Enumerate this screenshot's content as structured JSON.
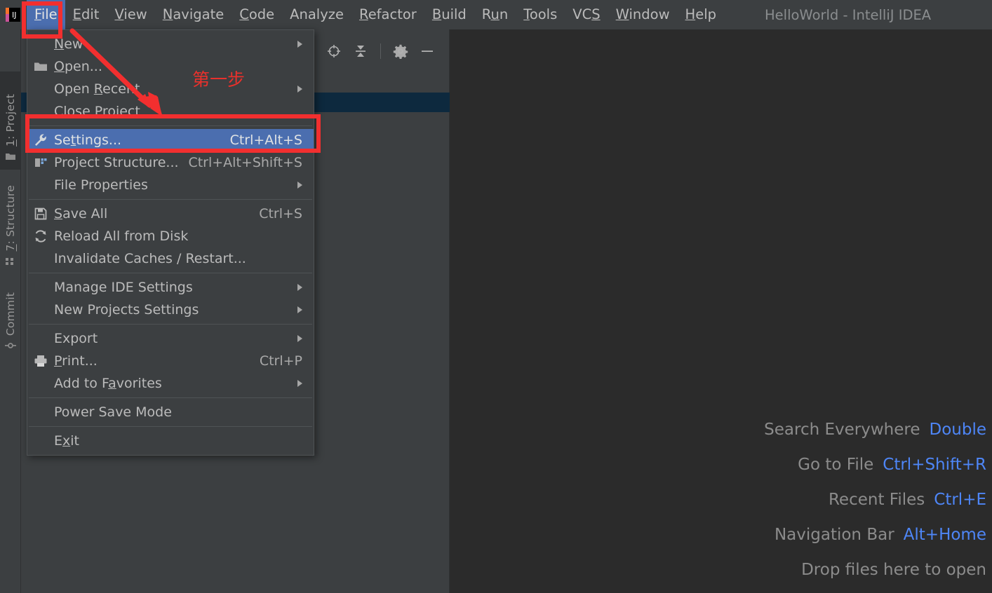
{
  "window": {
    "title": "HelloWorld - IntelliJ IDEA"
  },
  "menubar": {
    "items": [
      {
        "label": "File",
        "mnemonic": "F",
        "active": true
      },
      {
        "label": "Edit",
        "mnemonic": "E",
        "active": false
      },
      {
        "label": "View",
        "mnemonic": "V",
        "active": false
      },
      {
        "label": "Navigate",
        "mnemonic": "N",
        "active": false
      },
      {
        "label": "Code",
        "mnemonic": "C",
        "active": false
      },
      {
        "label": "Analyze",
        "mnemonic": "",
        "active": false
      },
      {
        "label": "Refactor",
        "mnemonic": "R",
        "active": false
      },
      {
        "label": "Build",
        "mnemonic": "B",
        "active": false
      },
      {
        "label": "Run",
        "mnemonic": "u",
        "active": false
      },
      {
        "label": "Tools",
        "mnemonic": "T",
        "active": false
      },
      {
        "label": "VCS",
        "mnemonic": "S",
        "active": false
      },
      {
        "label": "Window",
        "mnemonic": "W",
        "active": false
      },
      {
        "label": "Help",
        "mnemonic": "H",
        "active": false
      }
    ]
  },
  "file_menu": {
    "items": [
      {
        "label": "New",
        "mnemonic": "N",
        "icon": "",
        "accel": "",
        "submenu": true,
        "separator_after": false,
        "highlight": false
      },
      {
        "label": "Open...",
        "mnemonic": "O",
        "icon": "folder-icon",
        "accel": "",
        "submenu": false,
        "separator_after": false,
        "highlight": false
      },
      {
        "label": "Open Recent",
        "mnemonic": "R",
        "icon": "",
        "accel": "",
        "submenu": true,
        "separator_after": false,
        "highlight": false
      },
      {
        "label": "Close Project",
        "mnemonic": "",
        "icon": "",
        "accel": "",
        "submenu": false,
        "separator_after": true,
        "highlight": false
      },
      {
        "label": "Settings...",
        "mnemonic": "t",
        "icon": "wrench-icon",
        "accel": "Ctrl+Alt+S",
        "submenu": false,
        "separator_after": false,
        "highlight": true
      },
      {
        "label": "Project Structure...",
        "mnemonic": "",
        "icon": "module-icon",
        "accel": "Ctrl+Alt+Shift+S",
        "submenu": false,
        "separator_after": false,
        "highlight": false
      },
      {
        "label": "File Properties",
        "mnemonic": "",
        "icon": "",
        "accel": "",
        "submenu": true,
        "separator_after": true,
        "highlight": false
      },
      {
        "label": "Save All",
        "mnemonic": "S",
        "icon": "save-icon",
        "accel": "Ctrl+S",
        "submenu": false,
        "separator_after": false,
        "highlight": false
      },
      {
        "label": "Reload All from Disk",
        "mnemonic": "",
        "icon": "reload-icon",
        "accel": "",
        "submenu": false,
        "separator_after": false,
        "highlight": false
      },
      {
        "label": "Invalidate Caches / Restart...",
        "mnemonic": "",
        "icon": "",
        "accel": "",
        "submenu": false,
        "separator_after": true,
        "highlight": false
      },
      {
        "label": "Manage IDE Settings",
        "mnemonic": "",
        "icon": "",
        "accel": "",
        "submenu": true,
        "separator_after": false,
        "highlight": false
      },
      {
        "label": "New Projects Settings",
        "mnemonic": "",
        "icon": "",
        "accel": "",
        "submenu": true,
        "separator_after": true,
        "highlight": false
      },
      {
        "label": "Export",
        "mnemonic": "",
        "icon": "",
        "accel": "",
        "submenu": true,
        "separator_after": false,
        "highlight": false
      },
      {
        "label": "Print...",
        "mnemonic": "P",
        "icon": "print-icon",
        "accel": "Ctrl+P",
        "submenu": false,
        "separator_after": false,
        "highlight": false
      },
      {
        "label": "Add to Favorites",
        "mnemonic": "a",
        "icon": "",
        "accel": "",
        "submenu": true,
        "separator_after": true,
        "highlight": false
      },
      {
        "label": "Power Save Mode",
        "mnemonic": "",
        "icon": "",
        "accel": "",
        "submenu": false,
        "separator_after": true,
        "highlight": false
      },
      {
        "label": "Exit",
        "mnemonic": "x",
        "icon": "",
        "accel": "",
        "submenu": false,
        "separator_after": false,
        "highlight": false
      }
    ]
  },
  "tool_stripes": [
    {
      "label": "1: Project",
      "mnemonic": "1",
      "icon": "folder-icon",
      "selected": true
    },
    {
      "label": "7: Structure",
      "mnemonic": "7",
      "icon": "structure-icon",
      "selected": false
    },
    {
      "label": "Commit",
      "mnemonic": "",
      "icon": "commit-icon",
      "selected": false
    }
  ],
  "project_toolbar": {
    "buttons": [
      {
        "name": "locate-icon",
        "title": "Select Opened File"
      },
      {
        "name": "collapse-all-icon",
        "title": "Collapse All"
      },
      {
        "name": "gear-icon",
        "title": "Settings"
      },
      {
        "name": "minimize-icon",
        "title": "Hide"
      }
    ]
  },
  "editor_hints": [
    {
      "label": "Search Everywhere",
      "key": "Double"
    },
    {
      "label": "Go to File",
      "key": "Ctrl+Shift+R"
    },
    {
      "label": "Recent Files",
      "key": "Ctrl+E"
    },
    {
      "label": "Navigation Bar",
      "key": "Alt+Home"
    },
    {
      "label": "Drop files here to open",
      "key": ""
    }
  ],
  "annotations": {
    "step_note": "第一步",
    "color": "#f22f2f"
  },
  "colors": {
    "panel_bg": "#3c3f41",
    "editor_bg": "#2b2b2b",
    "selection_blue": "#4b6eaf",
    "tree_selection": "#0d293e",
    "hint_key_blue": "#4e86f7",
    "annotation_red": "#f22f2f",
    "text": "#bbbbbb"
  }
}
